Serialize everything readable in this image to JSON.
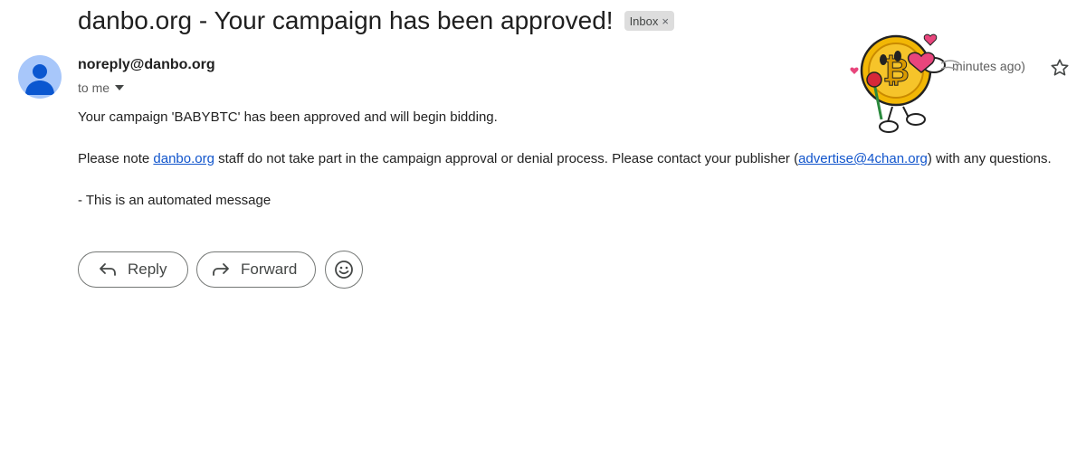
{
  "email": {
    "subject": "danbo.org - Your campaign has been approved!",
    "label_chip": "Inbox",
    "label_chip_close": "×",
    "sender": "noreply@danbo.org",
    "recipient": "to me",
    "time": "minutes ago)",
    "body": {
      "line1": "Your campaign 'BABYBTC' has been approved and will begin bidding.",
      "line2_prefix": "Please note ",
      "line2_link": "danbo.org",
      "line2_middle": " staff do not take part in the campaign approval or denial process. Please contact your publisher (",
      "line2_email": "advertise@4chan.org",
      "line2_suffix": ") with any questions.",
      "line3": "- This is an automated message"
    }
  },
  "actions": {
    "reply_label": "Reply",
    "forward_label": "Forward"
  },
  "icons": {
    "star": "star-outline-icon",
    "reply": "reply-arrow-icon",
    "forward": "forward-arrow-icon",
    "emoji": "smiley-icon",
    "dropdown": "caret-down-icon",
    "sticker": "bitcoin-mascot-sticker"
  },
  "colors": {
    "link": "#1155cc",
    "avatar_bg": "#a8c7fa",
    "avatar_fg": "#0b57d0",
    "chip_bg": "#dddddd",
    "coin": "#f2b705"
  }
}
